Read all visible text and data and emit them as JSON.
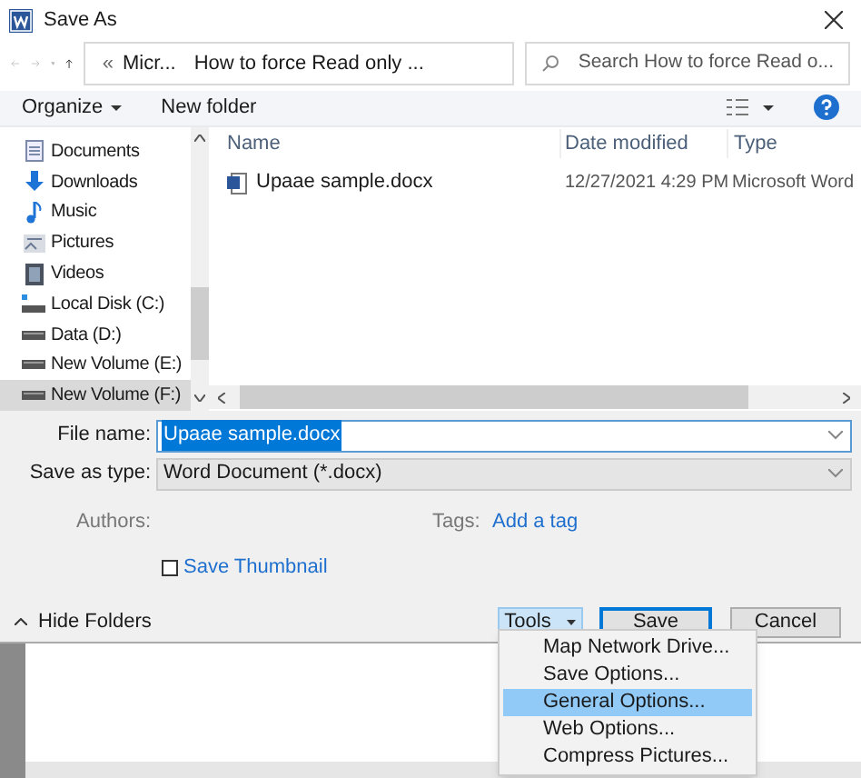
{
  "window": {
    "title": "Save As"
  },
  "address": {
    "overflow": "«",
    "path": [
      "Micr...",
      "How to force Read only ..."
    ]
  },
  "search": {
    "placeholder": "Search How to force Read o..."
  },
  "toolbar": {
    "organize": "Organize",
    "new_folder": "New folder"
  },
  "sidebar": {
    "items": [
      {
        "label": "Documents",
        "kind": "documents",
        "selected": false
      },
      {
        "label": "Downloads",
        "kind": "downloads",
        "selected": false
      },
      {
        "label": "Music",
        "kind": "music",
        "selected": false
      },
      {
        "label": "Pictures",
        "kind": "pictures",
        "selected": false
      },
      {
        "label": "Videos",
        "kind": "videos",
        "selected": false
      },
      {
        "label": "Local Disk (C:)",
        "kind": "systemdrive",
        "selected": false
      },
      {
        "label": "Data (D:)",
        "kind": "drive",
        "selected": false
      },
      {
        "label": "New Volume (E:)",
        "kind": "drive",
        "selected": false
      },
      {
        "label": "New Volume (F:)",
        "kind": "drive",
        "selected": true
      }
    ]
  },
  "table": {
    "columns": [
      "Name",
      "Date modified",
      "Type"
    ],
    "rows": [
      {
        "name": "Upaae sample.docx",
        "date": "12/27/2021 4:29 PM",
        "type": "Microsoft Word"
      }
    ]
  },
  "form": {
    "file_name_label": "File name:",
    "file_name": "Upaae sample.docx",
    "type_label": "Save as type:",
    "type": "Word Document (*.docx)",
    "authors_label": "Authors:",
    "tags_label": "Tags:",
    "tags_link": "Add a tag",
    "thumbnail": {
      "label": "Save Thumbnail",
      "checked": false
    }
  },
  "footer": {
    "hide_folders": "Hide Folders",
    "tools": "Tools",
    "save": "Save",
    "cancel": "Cancel"
  },
  "tools_menu": [
    {
      "label": "Map Network Drive...",
      "selected": false
    },
    {
      "label": "Save Options...",
      "selected": false
    },
    {
      "label": "General Options...",
      "selected": true
    },
    {
      "label": "Web Options...",
      "selected": false
    },
    {
      "label": "Compress Pictures...",
      "selected": false
    }
  ]
}
